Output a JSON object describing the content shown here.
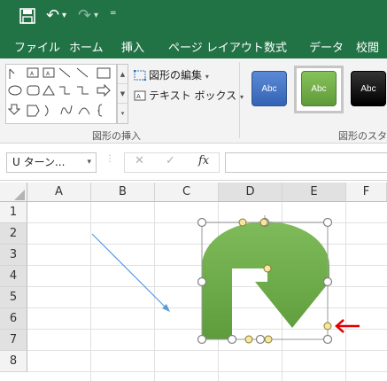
{
  "qat": {
    "save_icon": "save-icon",
    "undo_icon": "undo-icon",
    "redo_icon": "redo-icon",
    "customize_icon": "customize-qat-icon",
    "undo_glyph": "↶",
    "redo_glyph": "↷",
    "dropdown_glyph": "▾",
    "customize_glyph": "="
  },
  "ribbon_tabs": [
    "ファイル",
    "ホーム",
    "挿入",
    "ページ レイアウト",
    "数式",
    "データ",
    "校閲"
  ],
  "ribbon": {
    "edit_shape_label": "図形の編集",
    "textbox_label": "テキスト ボックス",
    "insert_shapes_group": "図形の挿入",
    "shape_styles_group": "図形のスタイ",
    "style_samples": [
      "Abc",
      "Abc",
      "Abc"
    ],
    "style_colors": [
      "#4472c4",
      "#70ad47",
      "#000000"
    ]
  },
  "formula_bar": {
    "name_box_value": "U ターン...",
    "cancel_glyph": "✕",
    "enter_glyph": "✓",
    "fx_label": "fx",
    "formula_value": ""
  },
  "sheet": {
    "columns": [
      "A",
      "B",
      "C",
      "D",
      "E",
      "F"
    ],
    "rows": [
      "1",
      "2",
      "3",
      "4",
      "5",
      "6",
      "7",
      "8"
    ]
  },
  "colors": {
    "excel_green": "#217346",
    "shape_fill": "#70ad47",
    "arrow_line": "#5b9bd5",
    "annotation_red": "#e00000",
    "adjust_handle": "#f5e6a0"
  },
  "annotation_arrow": "←"
}
